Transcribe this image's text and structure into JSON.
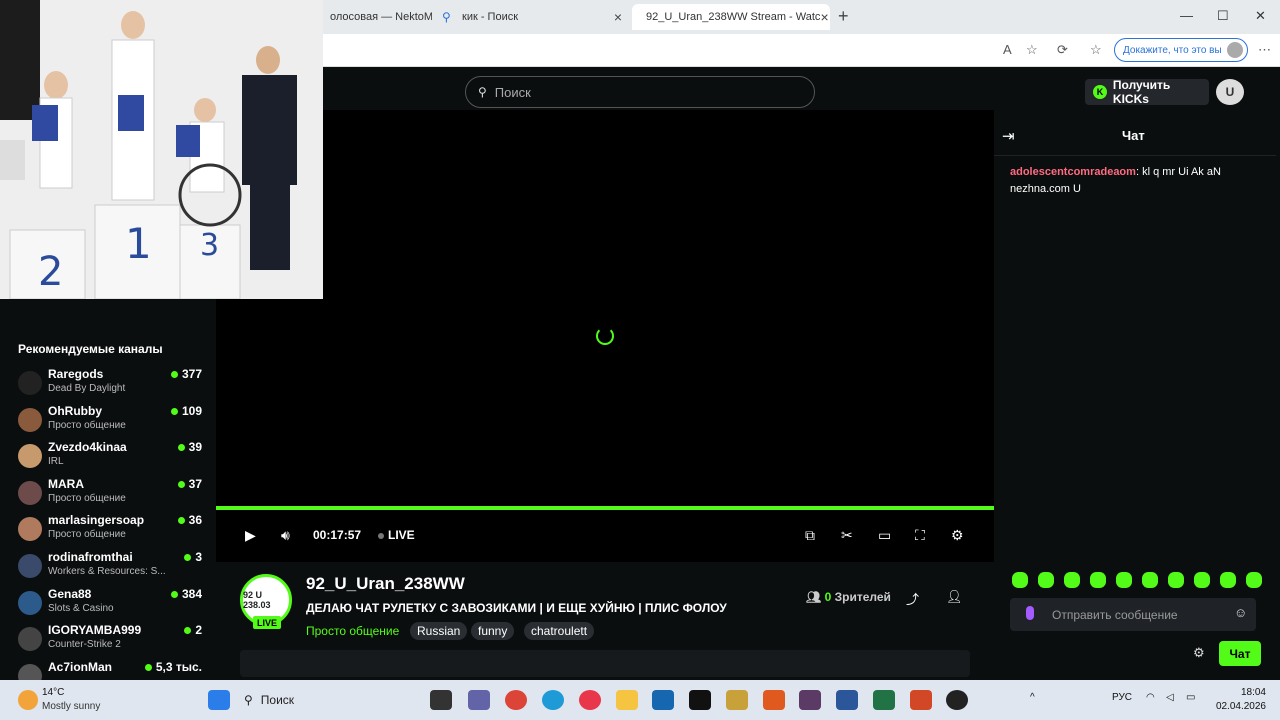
{
  "browser": {
    "tabs": [
      {
        "title": "олосовая — NektoM",
        "active": false
      },
      {
        "title": "кик - Поиск",
        "active": false
      },
      {
        "title": "92_U_Uran_238WW Stream - Watc",
        "active": true
      }
    ],
    "prove_label": "Докажите, что это вы"
  },
  "header": {
    "search_placeholder": "Поиск",
    "get_kicks": "Получить KICKs",
    "user_initial": "U"
  },
  "sidebar": {
    "title": "Рекомендуемые каналы",
    "channels": [
      {
        "name": "Raregods",
        "category": "Dead By Daylight",
        "viewers": "377",
        "avatar_color": "#222222"
      },
      {
        "name": "OhRubby",
        "category": "Просто общение",
        "viewers": "109",
        "avatar_color": "#8a5a3c"
      },
      {
        "name": "Zvezdo4kinaa",
        "category": "IRL",
        "viewers": "39",
        "avatar_color": "#c79a6d"
      },
      {
        "name": "MARA",
        "category": "Просто общение",
        "viewers": "37",
        "avatar_color": "#6e4b4b"
      },
      {
        "name": "marlasingersoap",
        "category": "Просто общение",
        "viewers": "36",
        "avatar_color": "#b07a5e"
      },
      {
        "name": "rodinafromthai",
        "category": "Workers & Resources: S...",
        "viewers": "3",
        "avatar_color": "#3a4a6a"
      },
      {
        "name": "Gena88",
        "category": "Slots & Casino",
        "viewers": "384",
        "avatar_color": "#2c5a8a"
      },
      {
        "name": "IGORYAMBA999",
        "category": "Counter-Strike 2",
        "viewers": "2",
        "avatar_color": "#444444"
      },
      {
        "name": "Ac7ionMan",
        "category": "",
        "viewers": "5,3 тыс.",
        "avatar_color": "#555555"
      }
    ]
  },
  "player": {
    "time": "00:17:57",
    "live": "LIVE",
    "progress": 1.0
  },
  "channel": {
    "name": "92_U_Uran_238WW",
    "title": "ДЕЛАЮ ЧАТ РУЛЕТКУ С ЗАВОЗИКАМИ | И ЕЩЕ ХУЙНЮ |  ПЛИС ФОЛОУ",
    "category": "Просто общение",
    "tags": [
      "Russian",
      "funny",
      "chatroulett"
    ],
    "viewers_count": "0",
    "viewers_label": "Зрителей",
    "avatar_text": "92 U 238.03",
    "live_badge": "LIVE"
  },
  "chat": {
    "title": "Чат",
    "messages": [
      {
        "user": "adolescentcomradeaom",
        "text": "kl q mr Ui Ak aN nezhna.com U"
      }
    ],
    "input_placeholder": "Отправить сообщение",
    "send_label": "Чат"
  },
  "taskbar": {
    "temperature": "14°C",
    "weather": "Mostly sunny",
    "search": "Поиск",
    "lang": "РУС",
    "time": "18:04",
    "date": "02.04.2026"
  },
  "colors": {
    "accent": "#53fc18",
    "username": "#ff6b81"
  }
}
